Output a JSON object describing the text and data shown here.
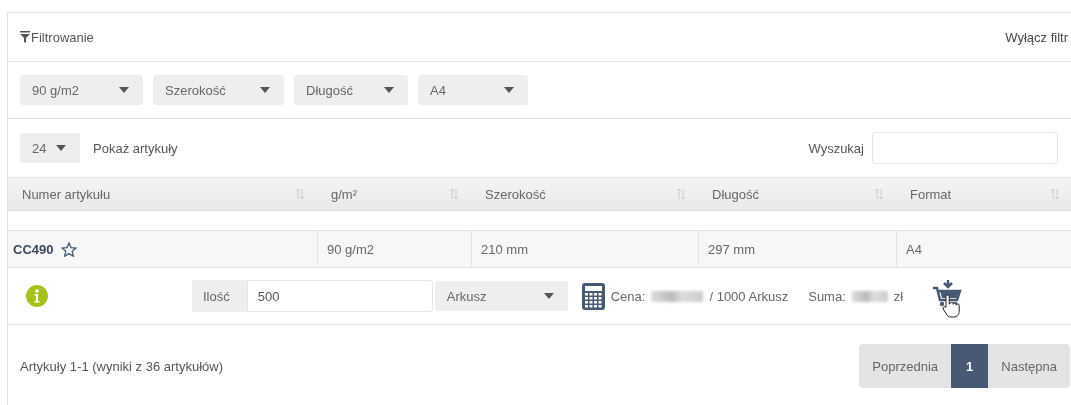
{
  "filter": {
    "title": "Filtrowanie",
    "clear_link": "Wyłącz filtr"
  },
  "filter_selects": [
    {
      "value": "90 g/m2"
    },
    {
      "value": "Szerokość"
    },
    {
      "value": "Długość"
    },
    {
      "value": "A4"
    }
  ],
  "page_size": {
    "value": "24",
    "label": "Pokaż artykuły"
  },
  "search": {
    "label": "Wyszukaj"
  },
  "table": {
    "columns": [
      "Numer artykułu",
      "g/m²",
      "Szerokość",
      "Długość",
      "Format"
    ],
    "rows": [
      {
        "cells": [
          "CC490",
          "90 g/m2",
          "210 mm",
          "297 mm",
          "A4"
        ],
        "favorite": false
      }
    ]
  },
  "order": {
    "quantity_label": "Ilość",
    "quantity": "500",
    "unit": "Arkusz",
    "price_label": "Cena:",
    "price_unit": "/ 1000 Arkusz",
    "sum_label": "Suma:",
    "currency": "zł"
  },
  "footer": {
    "summary": "Artykuły 1-1 (wyniki z 36 artykułów)",
    "pagination": [
      {
        "label": "Poprzednia",
        "selected": false
      },
      {
        "label": "1",
        "selected": true
      },
      {
        "label": "Następna",
        "selected": false
      }
    ]
  }
}
